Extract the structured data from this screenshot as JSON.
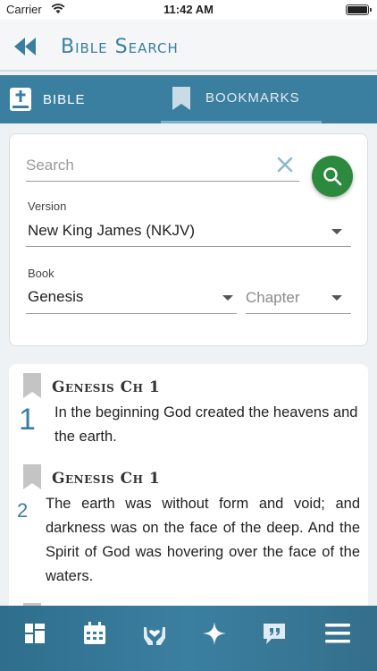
{
  "status_bar": {
    "carrier": "Carrier",
    "time": "11:42 AM"
  },
  "header": {
    "title": "Bible Search",
    "back_icon": "double-chevron-left-icon"
  },
  "tabs": [
    {
      "label": "BIBLE",
      "icon": "bible-icon",
      "active": false
    },
    {
      "label": "BOOKMARKS",
      "icon": "bookmark-icon",
      "active": true
    }
  ],
  "search_form": {
    "search_placeholder": "Search",
    "search_value": "",
    "version_label": "Version",
    "version_value": "New King James (NKJV)",
    "book_label": "Book",
    "book_value": "Genesis",
    "chapter_placeholder": "Chapter"
  },
  "results": [
    {
      "reference": "Genesis Ch 1",
      "verse_number": "1",
      "text": "In the beginning God created the heavens and the earth."
    },
    {
      "reference": "Genesis Ch 1",
      "verse_number": "2",
      "text": "The earth was without form and void; and darkness was on the face of the deep. And the Spirit of God was hovering over the face of the waters."
    }
  ],
  "bottom_nav": [
    {
      "icon": "dashboard-icon"
    },
    {
      "icon": "calendar-icon"
    },
    {
      "icon": "prayer-hands-icon"
    },
    {
      "icon": "sparkle-icon"
    },
    {
      "icon": "quote-bubble-icon"
    },
    {
      "icon": "menu-icon"
    }
  ],
  "colors": {
    "primary": "#3b7fa0",
    "title": "#3a7f9e",
    "search_button": "#2b8a3e",
    "background": "#eef2f5"
  }
}
